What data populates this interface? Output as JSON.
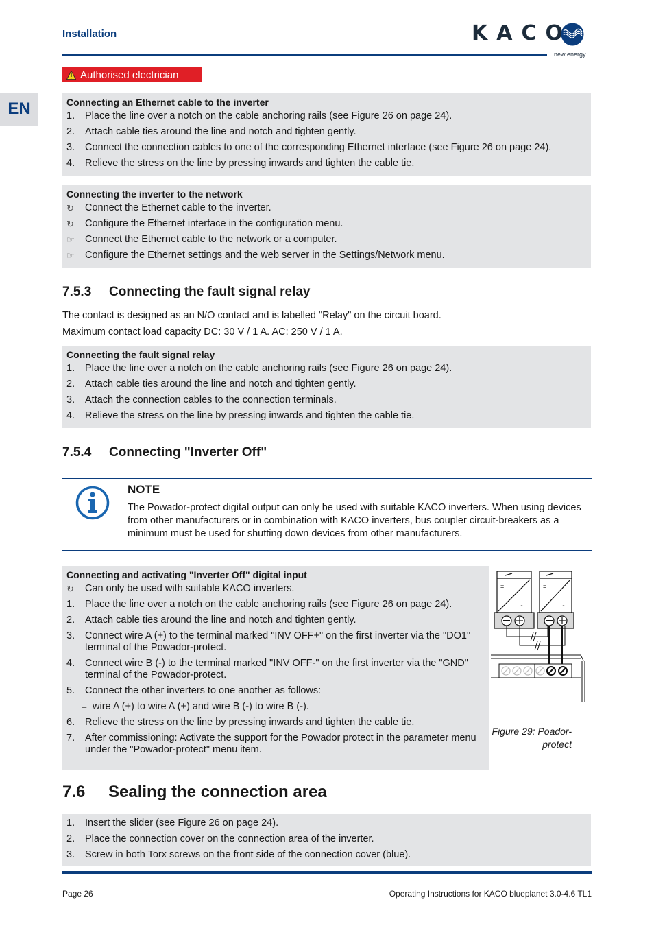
{
  "header": {
    "section": "Installation",
    "logo_text": "KACO",
    "logo_tagline": "new energy.",
    "brand_color": "#0b3d7d"
  },
  "badge": {
    "label": "Authorised electrician",
    "icon": "warning-icon",
    "color": "#e01f26"
  },
  "language_tab": "EN",
  "box_ethernet_cable": {
    "title": "Connecting an Ethernet cable to the inverter",
    "items": [
      {
        "marker": "1.",
        "text": "Place the line over a notch on the cable anchoring rails (see Figure 26 on page 24)."
      },
      {
        "marker": "2.",
        "text": "Attach cable ties around the line and notch and tighten gently."
      },
      {
        "marker": "3.",
        "text": "Connect the connection cables to one of the corresponding Ethernet interface (see Figure 26 on page 24)."
      },
      {
        "marker": "4.",
        "text": "Relieve the stress on the line by pressing inwards and tighten the cable tie."
      }
    ]
  },
  "box_network": {
    "title": "Connecting the inverter to the network",
    "items": [
      {
        "marker": "↻",
        "icon": "prerequisite-icon",
        "text": "Connect the Ethernet cable to the inverter."
      },
      {
        "marker": "↻",
        "icon": "prerequisite-icon",
        "text": "Configure the Ethernet interface in the configuration menu."
      },
      {
        "marker": "☞",
        "icon": "pointing-hand-icon",
        "text": "Connect the Ethernet cable to the network or a computer."
      },
      {
        "marker": "☞",
        "icon": "pointing-hand-icon",
        "text": "Configure the Ethernet settings and the web server in the Settings/Network menu."
      }
    ]
  },
  "section_753": {
    "number": "7.5.3",
    "title": "Connecting the fault signal relay",
    "para1": "The contact is designed as an N/O contact and is labelled \"Relay\" on the circuit board.",
    "para2": "Maximum contact load capacity DC: 30 V / 1 A. AC: 250 V / 1 A."
  },
  "box_relay": {
    "title": "Connecting the fault signal relay",
    "items": [
      {
        "marker": "1.",
        "text": "Place the line over a notch on the cable anchoring rails (see Figure 26 on page 24)."
      },
      {
        "marker": "2.",
        "text": "Attach cable ties around the line and notch and tighten gently."
      },
      {
        "marker": "3.",
        "text": "Attach the connection cables to the connection terminals."
      },
      {
        "marker": "4.",
        "text": "Relieve the stress on the line by pressing inwards and tighten the cable tie."
      }
    ]
  },
  "section_754": {
    "number": "7.5.4",
    "title": "Connecting \"Inverter Off\""
  },
  "note": {
    "title": "NOTE",
    "icon": "info-icon",
    "body": "The Powador-protect digital output can only be used with suitable KACO inverters.  When using devices from other manufacturers or in combination with KACO inverters, bus coupler circuit-breakers as a minimum must be used for shutting down devices from other manufacturers."
  },
  "box_inverter_off": {
    "title": "Connecting and activating \"Inverter Off\" digital input",
    "items": [
      {
        "marker": "↻",
        "text": "Can only be used with suitable KACO inverters."
      },
      {
        "marker": "1.",
        "text": "Place the line over a notch on the cable anchoring rails (see Figure 26 on page 24)."
      },
      {
        "marker": "2.",
        "text": "Attach cable ties around the line and notch and tighten gently."
      },
      {
        "marker": "3.",
        "text": "Connect wire A (+) to the terminal marked \"INV OFF+\" on the first inverter via the \"DO1\" terminal of the Powador-protect."
      },
      {
        "marker": "4.",
        "text": "Connect wire B (-) to the terminal marked \"INV OFF-\" on the first inverter via the \"GND\" terminal of the Powador-protect."
      },
      {
        "marker": "5.",
        "text": "Connect the other inverters to one another as follows:"
      },
      {
        "marker": "–",
        "text": "wire A (+) to wire A (+) and wire B (-) to wire B (-)."
      },
      {
        "marker": "6.",
        "text": "Relieve the stress on the line by pressing inwards and tighten the cable tie."
      },
      {
        "marker": "7.",
        "text": "After commissioning: Activate the support for the Powador protect in the parameter menu under the \"Powador-protect\" menu item."
      }
    ]
  },
  "figure": {
    "caption": "Figure 29: Poador-protect"
  },
  "section_76": {
    "number": "7.6",
    "title": "Sealing the connection area"
  },
  "box_sealing": {
    "items": [
      {
        "marker": "1.",
        "text": "Insert the slider (see Figure 26 on page 24)."
      },
      {
        "marker": "2.",
        "text": "Place the connection cover on the connection area of the inverter."
      },
      {
        "marker": "3.",
        "text": "Screw in both Torx screws on the front side of the connection cover (blue)."
      }
    ]
  },
  "footer": {
    "page": "Page 26",
    "doc_title": "Operating Instructions for KACO blueplanet 3.0-4.6 TL1"
  }
}
